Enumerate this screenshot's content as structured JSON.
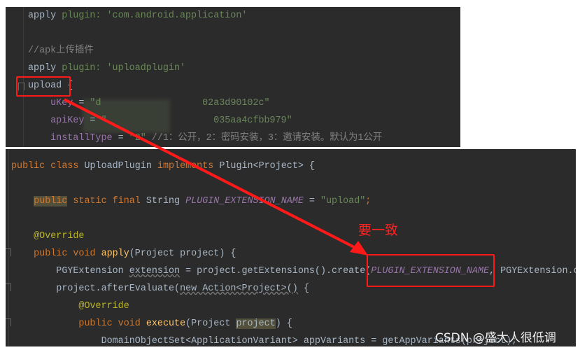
{
  "colors": {
    "background": "#2b2b2b",
    "keyword": "#cc7832",
    "string": "#6a8759",
    "field": "#9876aa",
    "comment": "#808080",
    "annotation": "#bbb529",
    "method": "#ffc66d",
    "text": "#a9b7c6",
    "annotation_red": "#ff1a1a"
  },
  "top_editor": {
    "lines": [
      [
        [
          "apply ",
          "txt"
        ],
        [
          "plugin: ",
          "str"
        ],
        [
          "'com.android.application'",
          "str"
        ]
      ],
      [],
      [
        [
          "//apk上传插件",
          "cmt"
        ]
      ],
      [
        [
          "apply ",
          "txt"
        ],
        [
          "plugin: ",
          "str"
        ],
        [
          "'uploadplugin'",
          "str"
        ]
      ],
      [
        [
          "upload",
          "txt"
        ],
        [
          " {",
          "txt"
        ]
      ],
      [
        [
          "    uKey",
          "fld2"
        ],
        [
          " = ",
          "txt"
        ],
        [
          "\"d",
          "str"
        ],
        [
          "                  ",
          "txt"
        ],
        [
          "02a3d90102c\"",
          "str"
        ]
      ],
      [
        [
          "    apiKey",
          "fld2"
        ],
        [
          " = ",
          "txt"
        ],
        [
          "\"",
          "str"
        ],
        [
          "                   ",
          "txt"
        ],
        [
          "035aa4cfbb979\"",
          "str"
        ]
      ],
      [
        [
          "    installType",
          "fld2"
        ],
        [
          " = ",
          "txt"
        ],
        [
          "\"2\"",
          "str"
        ],
        [
          " //1：公开，2：密码安装，3：邀请安装。默认为1公开",
          "cmt"
        ]
      ]
    ]
  },
  "bottom_editor": {
    "lines": [
      [
        [
          "public class ",
          "kw"
        ],
        [
          "UploadPlugin ",
          "txt"
        ],
        [
          "implements ",
          "kw"
        ],
        [
          "Plugin<Project> {",
          "txt"
        ]
      ],
      [],
      [
        [
          "    ",
          "txt"
        ],
        [
          "public",
          "kw hl"
        ],
        [
          " static final ",
          "kw"
        ],
        [
          "String ",
          "txt"
        ],
        [
          "PLUGIN_EXTENSION_NAME",
          "fld"
        ],
        [
          " = ",
          "txt"
        ],
        [
          "\"upload\"",
          "str"
        ],
        [
          ";",
          "kw"
        ]
      ],
      [],
      [
        [
          "    @Override",
          "ann"
        ]
      ],
      [
        [
          "    public void ",
          "kw"
        ],
        [
          "apply",
          "mth"
        ],
        [
          "(Project project) {",
          "txt"
        ]
      ],
      [
        [
          "        PGYExtension ",
          "txt"
        ],
        [
          "extension",
          "unused"
        ],
        [
          " = project.getExtensions().create(",
          "txt"
        ],
        [
          "PLUGIN_EXTENSION_NAME",
          "fld"
        ],
        [
          ", PGYExtension.c",
          "txt"
        ]
      ],
      [
        [
          "        project.afterEvaluate(",
          "txt"
        ],
        [
          "new Action<Project>()",
          "unused"
        ],
        [
          " {",
          "txt"
        ]
      ],
      [
        [
          "            @Override",
          "ann"
        ]
      ],
      [
        [
          "            public void ",
          "kw"
        ],
        [
          "execute",
          "mth"
        ],
        [
          "(Project ",
          "txt"
        ],
        [
          "project",
          "txt hl"
        ],
        [
          ") {",
          "txt"
        ]
      ],
      [
        [
          "                DomainObjectSet<ApplicationVariant> appVariants = getAppVariants(project);",
          "txt"
        ]
      ]
    ]
  },
  "annotation": {
    "note": "要一致"
  },
  "watermark": "CSDN @盛大人很低调"
}
